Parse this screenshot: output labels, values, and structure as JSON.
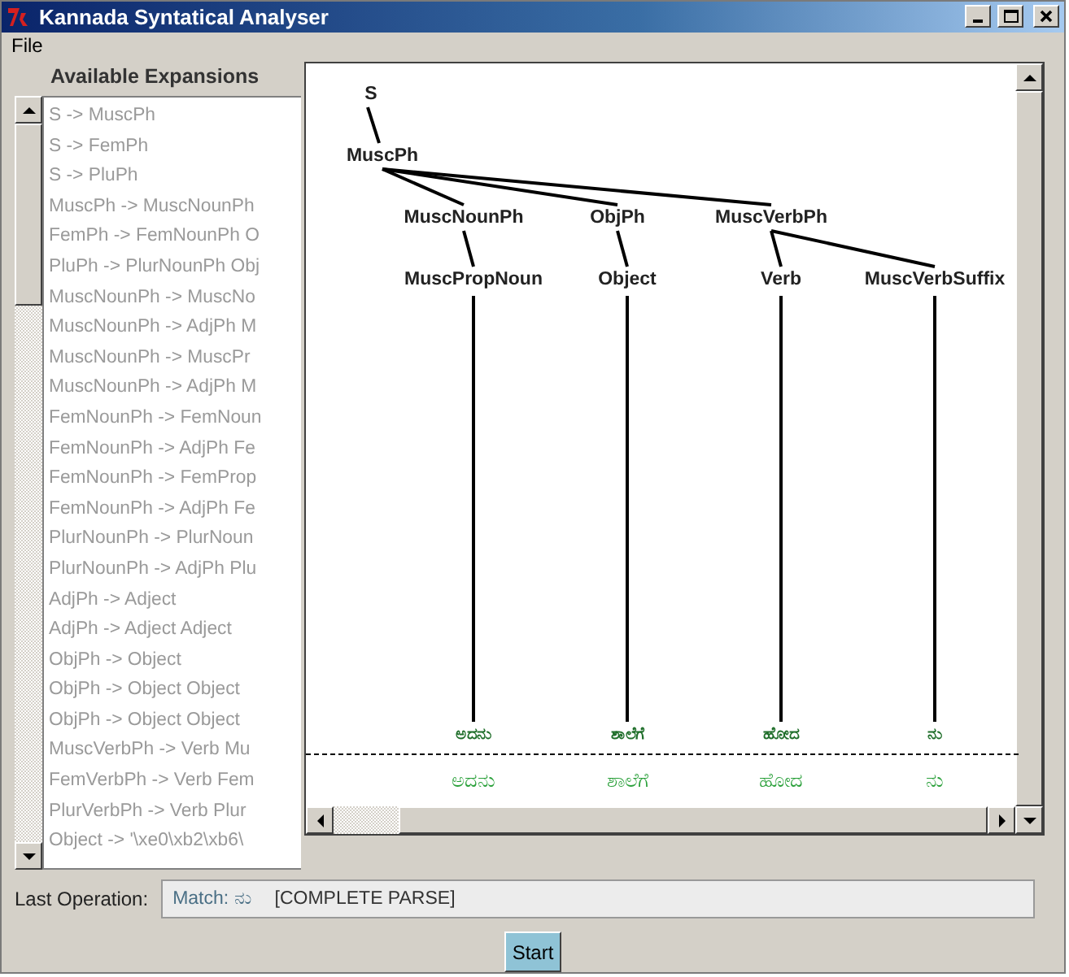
{
  "window": {
    "title": "Kannada Syntatical Analyser"
  },
  "menu": [
    {
      "label": "File"
    }
  ],
  "expansions": {
    "heading": "Available Expansions",
    "items": [
      "S -> MuscPh",
      "S -> FemPh",
      "S -> PluPh",
      "MuscPh -> MuscNounPh",
      "FemPh -> FemNounPh O",
      "PluPh -> PlurNounPh Obj",
      "MuscNounPh -> MuscNo",
      "MuscNounPh -> AdjPh M",
      "MuscNounPh -> MuscPr",
      "MuscNounPh -> AdjPh M",
      "FemNounPh -> FemNoun",
      "FemNounPh -> AdjPh Fe",
      "FemNounPh -> FemProp",
      "FemNounPh -> AdjPh Fe",
      "PlurNounPh -> PlurNoun",
      "PlurNounPh -> AdjPh Plu",
      "AdjPh -> Adject",
      "AdjPh -> Adject Adject",
      "ObjPh -> Object",
      "ObjPh -> Object Object",
      "ObjPh -> Object Object",
      "MuscVerbPh -> Verb Mu",
      "FemVerbPh -> Verb Fem",
      "PlurVerbPh -> Verb Plur",
      "Object -> '\\xe0\\xb2\\xb6\\"
    ]
  },
  "parse_tree": {
    "label": "S",
    "children": [
      {
        "label": "MuscPh",
        "children": [
          {
            "label": "MuscNounPh",
            "children": [
              {
                "label": "MuscPropNoun",
                "token": "ಅದನು",
                "word": "ಅದನು"
              }
            ]
          },
          {
            "label": "ObjPh",
            "children": [
              {
                "label": "Object",
                "token": "ಶಾಲೆಗೆ",
                "word": "ಶಾಲೆಗೆ"
              }
            ]
          },
          {
            "label": "MuscVerbPh",
            "children": [
              {
                "label": "Verb",
                "token": "ಹೋದ",
                "word": "ಹೋದ"
              },
              {
                "label": "MuscVerbSuffix",
                "token": "ನು",
                "word": "ನು"
              }
            ]
          }
        ]
      }
    ]
  },
  "last_operation": {
    "label": "Last Operation:",
    "match": "Match: ನು",
    "status": "[COMPLETE PARSE]"
  },
  "buttons": [
    {
      "label": "Start"
    }
  ]
}
